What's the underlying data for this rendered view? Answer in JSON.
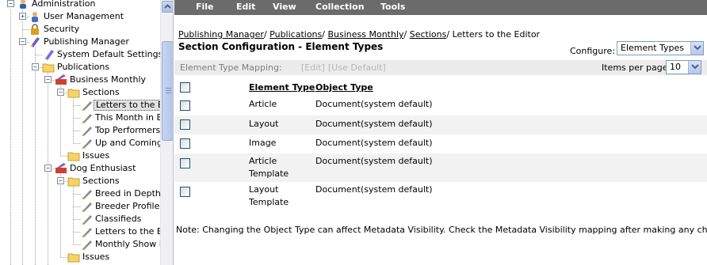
{
  "tree": {
    "nodes": [
      {
        "label": "Administration",
        "icon": "admin-icon"
      },
      {
        "label": "User Management",
        "icon": "user-icon"
      },
      {
        "label": "Security",
        "icon": "lock-icon"
      },
      {
        "label": "Publishing Manager",
        "icon": "publishing-icon"
      },
      {
        "label": "System Default Settings",
        "icon": "settings-icon"
      },
      {
        "label": "Publications",
        "icon": "folder-icon"
      },
      {
        "label": "Business Monthly",
        "icon": "publication-icon"
      },
      {
        "label": "Sections",
        "icon": "folder-icon"
      },
      {
        "label": "Letters to the E",
        "icon": "section-icon"
      },
      {
        "label": "This Month in Bu",
        "icon": "section-icon"
      },
      {
        "label": "Top Performers",
        "icon": "section-icon"
      },
      {
        "label": "Up and Coming",
        "icon": "section-icon"
      },
      {
        "label": "Issues",
        "icon": "folder-icon"
      },
      {
        "label": "Dog Enthusiast",
        "icon": "publication-icon"
      },
      {
        "label": "Sections",
        "icon": "folder-icon"
      },
      {
        "label": "Breed in Depth",
        "icon": "section-icon"
      },
      {
        "label": "Breeder Profile",
        "icon": "section-icon"
      },
      {
        "label": "Classifieds",
        "icon": "section-icon"
      },
      {
        "label": "Letters to the E",
        "icon": "section-icon"
      },
      {
        "label": "Monthly Show Re",
        "icon": "section-icon"
      },
      {
        "label": "Issues",
        "icon": "folder-icon"
      }
    ]
  },
  "menu": {
    "file": "File",
    "edit": "Edit",
    "view": "View",
    "collection": "Collection",
    "tools": "Tools"
  },
  "breadcrumb": {
    "items": [
      "Publishing Manager",
      "Publications",
      "Business Monthly",
      "Sections"
    ],
    "separator": "/",
    "current": "Letters to the Editor"
  },
  "page_title": "Section Configuration - Element Types",
  "configure": {
    "label": "Configure:",
    "selected": "Element Types"
  },
  "mapping": {
    "label": "Element Type Mapping:",
    "edit": "[Edit]",
    "use_default": "[Use Default]"
  },
  "items_per_page": {
    "label": "Items per page:",
    "selected": "10"
  },
  "table": {
    "columns": [
      "Element Type",
      "Object Type"
    ],
    "rows": [
      {
        "element_type": [
          "Article"
        ],
        "object_type": "Document(system default)"
      },
      {
        "element_type": [
          "Layout"
        ],
        "object_type": "Document(system default)"
      },
      {
        "element_type": [
          "Image"
        ],
        "object_type": "Document(system default)"
      },
      {
        "element_type": [
          "Article",
          "Template"
        ],
        "object_type": "Document(system default)"
      },
      {
        "element_type": [
          "Layout",
          "Template"
        ],
        "object_type": "Document(system default)"
      }
    ]
  },
  "note": "Note: Changing the Object Type can affect Metadata Visibility. Check the Metadata Visibility mapping after making any changes.",
  "colors": {
    "menubar": "#6b6b6b",
    "mapping_bar": "#ececec",
    "row_alt": "#f2f2f2",
    "selection": "#e2e2e2"
  }
}
